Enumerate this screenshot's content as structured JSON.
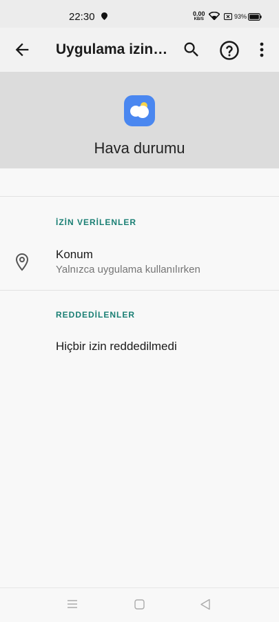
{
  "status_bar": {
    "time": "22:30",
    "speed_value": "0.00",
    "speed_unit": "KB/S",
    "battery": "93%"
  },
  "app_bar": {
    "title": "Uygulama izin…",
    "icons": [
      "back-arrow-icon",
      "search-icon",
      "help-icon",
      "more-vert-icon"
    ]
  },
  "app_header": {
    "app_name": "Hava durumu",
    "icon": "weather-icon",
    "icon_color": "#4a87f0"
  },
  "allowed_section": {
    "title": "İZİN VERİLENLER",
    "items": [
      {
        "title": "Konum",
        "subtitle": "Yalnızca uygulama kullanılırken",
        "icon": "location-pin-icon"
      }
    ]
  },
  "denied_section": {
    "title": "REDDEDİLENLER",
    "empty_text": "Hiçbir izin reddedilmedi"
  },
  "nav_bar": {
    "icons": [
      "menu-icon",
      "home-icon",
      "back-triangle-icon"
    ]
  },
  "colors": {
    "accent": "#1a7f74",
    "header_bg": "#dcdcdc",
    "background": "#f8f8f8"
  }
}
